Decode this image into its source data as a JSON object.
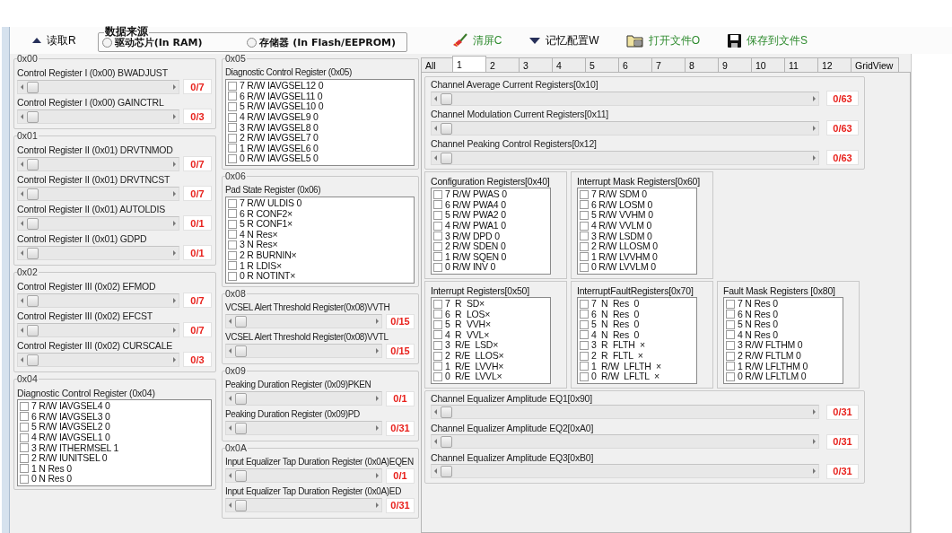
{
  "toolbar": {
    "read_button": "读取R",
    "data_source": {
      "title": "数据来源",
      "options": [
        {
          "label": "驱动芯片(In RAM)",
          "selected": false
        },
        {
          "label": "存储器 (In Flash/EEPROM)",
          "selected": false
        }
      ]
    },
    "actions": [
      "清屏C",
      "记忆配置W",
      "打开文件O",
      "保存到文件S"
    ]
  },
  "left": {
    "groups": [
      {
        "title": "0x00",
        "kind": "sliders",
        "sliders": [
          {
            "label": "Control Register I (0x00) BWADJUST",
            "reading": "0/7"
          },
          {
            "label": "Control Register I (0x00) GAINCTRL",
            "reading": "0/3"
          }
        ]
      },
      {
        "title": "0x01",
        "kind": "sliders",
        "sliders": [
          {
            "label": "Control Register II (0x01) DRVTNMOD",
            "reading": "0/7"
          },
          {
            "label": "Control Register II (0x01) DRVTNCST",
            "reading": "0/7"
          },
          {
            "label": "Control Register II (0x01) AUTOLDIS",
            "reading": "0/1"
          },
          {
            "label": "Control Register II (0x01) GDPD",
            "reading": "0/1"
          }
        ]
      },
      {
        "title": "0x02",
        "kind": "sliders",
        "sliders": [
          {
            "label": "Control Register III (0x02) EFMOD",
            "reading": "0/7"
          },
          {
            "label": "Control Register III (0x02) EFCST",
            "reading": "0/7"
          },
          {
            "label": "Control Register III (0x02) CURSCALE",
            "reading": "0/3"
          }
        ]
      },
      {
        "title": "0x04",
        "kind": "checklist",
        "label": "Diagnostic Control Register (0x04)",
        "items": [
          {
            "text": "7 R/W IAVGSEL4 0",
            "checked": false
          },
          {
            "text": "6 R/W IAVGSEL3 0",
            "checked": false
          },
          {
            "text": "5 R/W IAVGSEL2 0",
            "checked": false
          },
          {
            "text": "4 R/W IAVGSEL1 0",
            "checked": false
          },
          {
            "text": "3 R/W ITHERMSEL 1",
            "checked": false
          },
          {
            "text": "2 R/W IUNITSEL 0",
            "checked": false
          },
          {
            "text": "1 N Res 0",
            "checked": false
          },
          {
            "text": "0 N Res 0",
            "checked": false
          }
        ]
      }
    ]
  },
  "middle": {
    "groups": [
      {
        "title": "0x05",
        "kind": "checklist",
        "label": "Diagnostic Control Register (0x05)",
        "items": [
          {
            "text": "7 R/W IAVGSEL12 0",
            "checked": false
          },
          {
            "text": "6 R/W IAVGSEL11 0",
            "checked": false
          },
          {
            "text": "5 R/W IAVGSEL10 0",
            "checked": false
          },
          {
            "text": "4 R/W IAVGSEL9 0",
            "checked": false
          },
          {
            "text": "3 R/W IAVGSEL8 0",
            "checked": false
          },
          {
            "text": "2 R/W IAVGSEL7 0",
            "checked": false
          },
          {
            "text": "1 R/W IAVGSEL6 0",
            "checked": false
          },
          {
            "text": "0 R/W IAVGSEL5 0",
            "checked": false
          }
        ]
      },
      {
        "title": "0x06",
        "kind": "checklist",
        "label": "Pad State Register (0x06)",
        "items": [
          {
            "text": "7 R/W ULDIS 0",
            "checked": false
          },
          {
            "text": "6 R CONF2×",
            "checked": false
          },
          {
            "text": "5 R CONF1×",
            "checked": false
          },
          {
            "text": "4 N Res×",
            "checked": false
          },
          {
            "text": "3 N Res×",
            "checked": false
          },
          {
            "text": "2 R BURNIN×",
            "checked": false
          },
          {
            "text": "1 R LDIS×",
            "checked": false
          },
          {
            "text": "0 R NOTINT×",
            "checked": false
          }
        ]
      },
      {
        "title": "0x08",
        "kind": "sliders",
        "sliders": [
          {
            "label": "VCSEL Alert Threshold Register(0x08)VVTH",
            "reading": "0/15"
          },
          {
            "label": "VCSEL Alert Threshold Register(0x08)VVTL",
            "reading": "0/15"
          }
        ]
      },
      {
        "title": "0x09",
        "kind": "sliders",
        "sliders": [
          {
            "label": "Peaking Duration Register (0x09)PKEN",
            "reading": "0/1"
          },
          {
            "label": "Peaking Duration Register (0x09)PD",
            "reading": "0/31"
          }
        ]
      },
      {
        "title": "0x0A",
        "kind": "sliders",
        "sliders": [
          {
            "label": "Input Equalizer Tap Duration Register (0x0A)EQEN",
            "reading": "0/1"
          },
          {
            "label": "Input Equalizer Tap Duration Register (0x0A)ED",
            "reading": "0/31"
          }
        ]
      }
    ]
  },
  "tabs": [
    {
      "label": "All",
      "selected": false
    },
    {
      "label": "1",
      "selected": true
    },
    {
      "label": "2",
      "selected": false
    },
    {
      "label": "3",
      "selected": false
    },
    {
      "label": "4",
      "selected": false
    },
    {
      "label": "5",
      "selected": false
    },
    {
      "label": "6",
      "selected": false
    },
    {
      "label": "7",
      "selected": false
    },
    {
      "label": "8",
      "selected": false
    },
    {
      "label": "9",
      "selected": false
    },
    {
      "label": "10",
      "selected": false
    },
    {
      "label": "11",
      "selected": false
    },
    {
      "label": "12",
      "selected": false
    },
    {
      "label": "GridView",
      "selected": false
    }
  ],
  "tab_panel": {
    "channel_sliders": [
      {
        "label": "Channel Average Current Registers[0x10]",
        "reading": "0/63"
      },
      {
        "label": "Channel Modulation Current Registers[0x11]",
        "reading": "0/63"
      },
      {
        "label": "Channel Peaking Control Registers[0x12]",
        "reading": "0/63"
      }
    ],
    "register_rows": [
      {
        "groups": [
          {
            "title": "Configuration Registers[0x40]",
            "items": [
              {
                "text": "7 R/W PWAS 0",
                "checked": false
              },
              {
                "text": "6 R/W PWA4 0",
                "checked": false
              },
              {
                "text": "5 R/W PWA2 0",
                "checked": false
              },
              {
                "text": "4 R/W PWA1 0",
                "checked": false
              },
              {
                "text": "3 R/W DPD 0",
                "checked": false
              },
              {
                "text": "2 R/W SDEN 0",
                "checked": false
              },
              {
                "text": "1 R/W SQEN 0",
                "checked": false
              },
              {
                "text": "0 R/W INV 0",
                "checked": false
              }
            ]
          },
          {
            "title": "Interrupt Mask Registers[0x60]",
            "items": [
              {
                "text": "7 R/W SDM 0",
                "checked": false
              },
              {
                "text": "6 R/W LOSM 0",
                "checked": false
              },
              {
                "text": "5 R/W VVHM 0",
                "checked": false
              },
              {
                "text": "4 R/W VVLM 0",
                "checked": false
              },
              {
                "text": "3 R/W LSDM 0",
                "checked": false
              },
              {
                "text": "2 R/W LLOSM 0",
                "checked": false
              },
              {
                "text": "1 R/W LVVHM 0",
                "checked": false
              },
              {
                "text": "0 R/W LVVLM 0",
                "checked": false
              }
            ]
          }
        ]
      },
      {
        "groups": [
          {
            "title": "Interrupt Registers[0x50]",
            "items": [
              {
                "text": "7  R  SD×",
                "checked": false
              },
              {
                "text": "6  R  LOS×",
                "checked": false
              },
              {
                "text": "5  R  VVH×",
                "checked": false
              },
              {
                "text": "4  R  VVL×",
                "checked": false
              },
              {
                "text": "3  R/E  LSD×",
                "checked": false
              },
              {
                "text": "2  R/E  LLOS×",
                "checked": false
              },
              {
                "text": "1  R/E  LVVH×",
                "checked": false
              },
              {
                "text": "0  R/E  LVVL×",
                "checked": false
              }
            ]
          },
          {
            "title": "InterruptFaultRegisters[0x70]",
            "items": [
              {
                "text": "7  N  Res  0",
                "checked": false
              },
              {
                "text": "6  N  Res  0",
                "checked": false
              },
              {
                "text": "5  N  Res  0",
                "checked": false
              },
              {
                "text": "4  N  Res  0",
                "checked": false
              },
              {
                "text": "3  R  FLTH  ×",
                "checked": false
              },
              {
                "text": "2  R  FLTL  ×",
                "checked": false
              },
              {
                "text": "1  R/W  LFLTH  ×",
                "checked": false
              },
              {
                "text": "0  R/W  LFLTL  ×",
                "checked": false
              }
            ]
          },
          {
            "title": "Fault Mask Registers [0x80]",
            "items": [
              {
                "text": "7 N Res 0",
                "checked": false
              },
              {
                "text": "6 N Res 0",
                "checked": false
              },
              {
                "text": "5 N Res 0",
                "checked": false
              },
              {
                "text": "4 N Res 0",
                "checked": false
              },
              {
                "text": "3 R/W FLTHM 0",
                "checked": false
              },
              {
                "text": "2 R/W FLTLM 0",
                "checked": false
              },
              {
                "text": "1 R/W LFLTHM 0",
                "checked": false
              },
              {
                "text": "0 R/W LFLTLM 0",
                "checked": false
              }
            ]
          }
        ]
      }
    ],
    "eq_sliders": [
      {
        "label": "Channel Equalizer Amplitude EQ1[0x90]",
        "reading": "0/31"
      },
      {
        "label": "Channel Equalizer Amplitude EQ2[0xA0]",
        "reading": "0/31"
      },
      {
        "label": "Channel Equalizer Amplitude EQ3[0xB0]",
        "reading": "0/31"
      }
    ]
  }
}
